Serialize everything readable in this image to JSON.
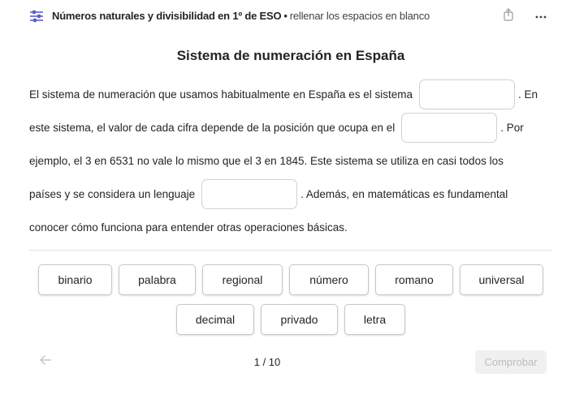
{
  "header": {
    "title": "Números naturales y divisibilidad en 1º de ESO",
    "separator": "•",
    "subtitle": "rellenar los espacios en blanco",
    "app_icon": "sliders-icon",
    "share_icon": "share-icon",
    "more_icon": "more-icon",
    "accent_color": "#5b5fc7"
  },
  "quiz": {
    "title": "Sistema de numeración en España",
    "lines": [
      {
        "before": "El sistema de numeración que usamos habitualmente en España es el sistema",
        "after": ". En"
      },
      {
        "before": "este sistema, el valor de cada cifra depende de la posición que ocupa en el",
        "after": ". Por"
      },
      {
        "before": "ejemplo, el 3 en 6531 no vale lo mismo que el 3 en 1845. Este sistema se utiliza en casi todos los",
        "after": ""
      },
      {
        "before": "países y se considera un lenguaje",
        "after": ". Además, en matemáticas es fundamental"
      },
      {
        "before": "conocer cómo funciona para entender otras operaciones básicas.",
        "after": ""
      }
    ],
    "blanks": [
      "",
      "",
      ""
    ]
  },
  "word_bank": {
    "row1": [
      "binario",
      "palabra",
      "regional",
      "número",
      "romano",
      "universal"
    ],
    "row2": [
      "decimal",
      "privado",
      "letra"
    ]
  },
  "footer": {
    "back_icon": "arrow-left-icon",
    "page_indicator": "1 / 10",
    "check_label": "Comprobar"
  }
}
